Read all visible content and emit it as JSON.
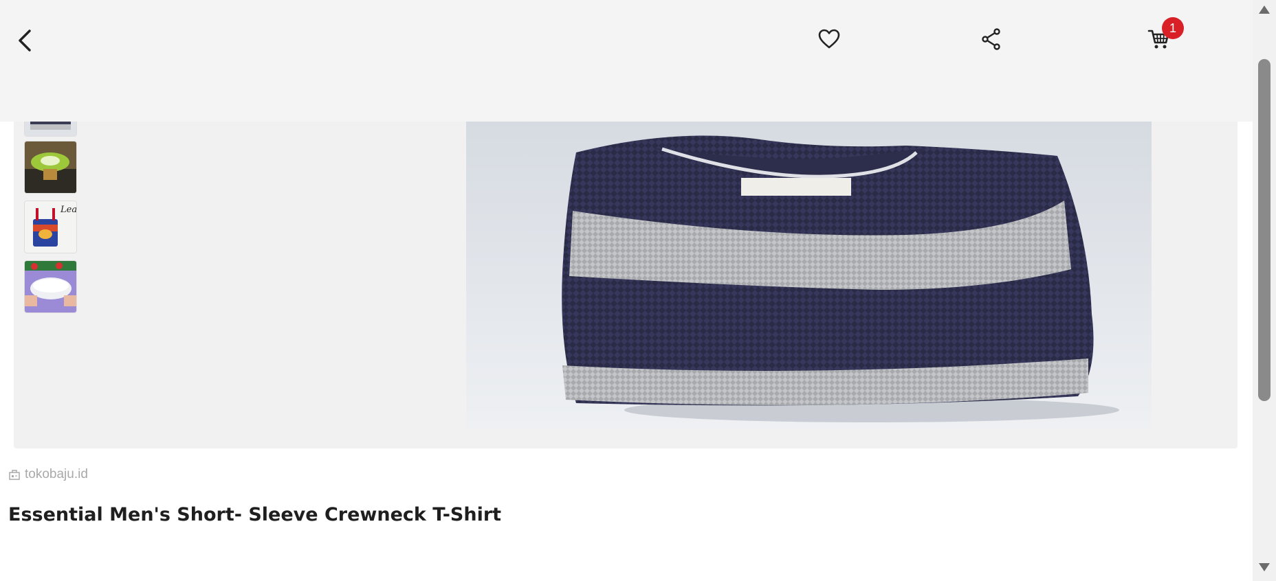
{
  "header": {
    "back_icon": "chevron-left-icon",
    "wishlist_icon": "heart-outline-icon",
    "share_icon": "share-icon",
    "cart_icon": "cart-icon",
    "cart_count": "1",
    "badge_color": "#d92027"
  },
  "gallery": {
    "thumbnails": [
      {
        "icon": "sweater-thumbnail"
      },
      {
        "icon": "green-bowl-thumbnail"
      },
      {
        "icon": "tin-can-thumbnail"
      },
      {
        "icon": "food-container-thumbnail"
      }
    ],
    "main_image": "striped-knit-sweater-image"
  },
  "product": {
    "shop_icon": "store-icon",
    "shop_name": "tokobaju.id",
    "title": "Essential Men's Short- Sleeve Crewneck T-Shirt"
  }
}
